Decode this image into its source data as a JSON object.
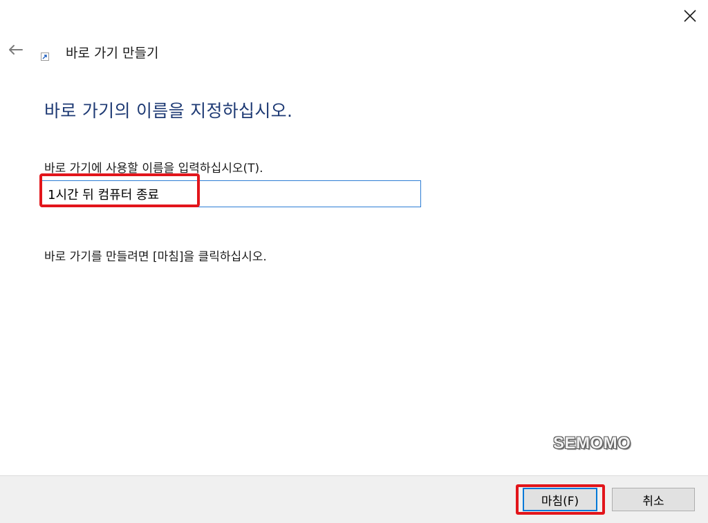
{
  "window": {
    "title": "바로 가기 만들기",
    "close_icon": "close-icon",
    "back_icon": "back-arrow-icon",
    "shortcut_icon": "shortcut-icon"
  },
  "main": {
    "heading": "바로 가기의 이름을 지정하십시오.",
    "field_label": "바로 가기에 사용할 이름을 입력하십시오(T).",
    "name_value": "1시간 뒤 컴퓨터 종료",
    "hint": "바로 가기를 만들려면 [마침]을 클릭하십시오."
  },
  "footer": {
    "finish_label": "마침(F)",
    "cancel_label": "취소"
  },
  "watermark": "SEMOMO",
  "colors": {
    "heading": "#1e3a74",
    "highlight": "#e2151b",
    "input_border": "#2b7bd4",
    "footer_bg": "#f0f0f0"
  }
}
